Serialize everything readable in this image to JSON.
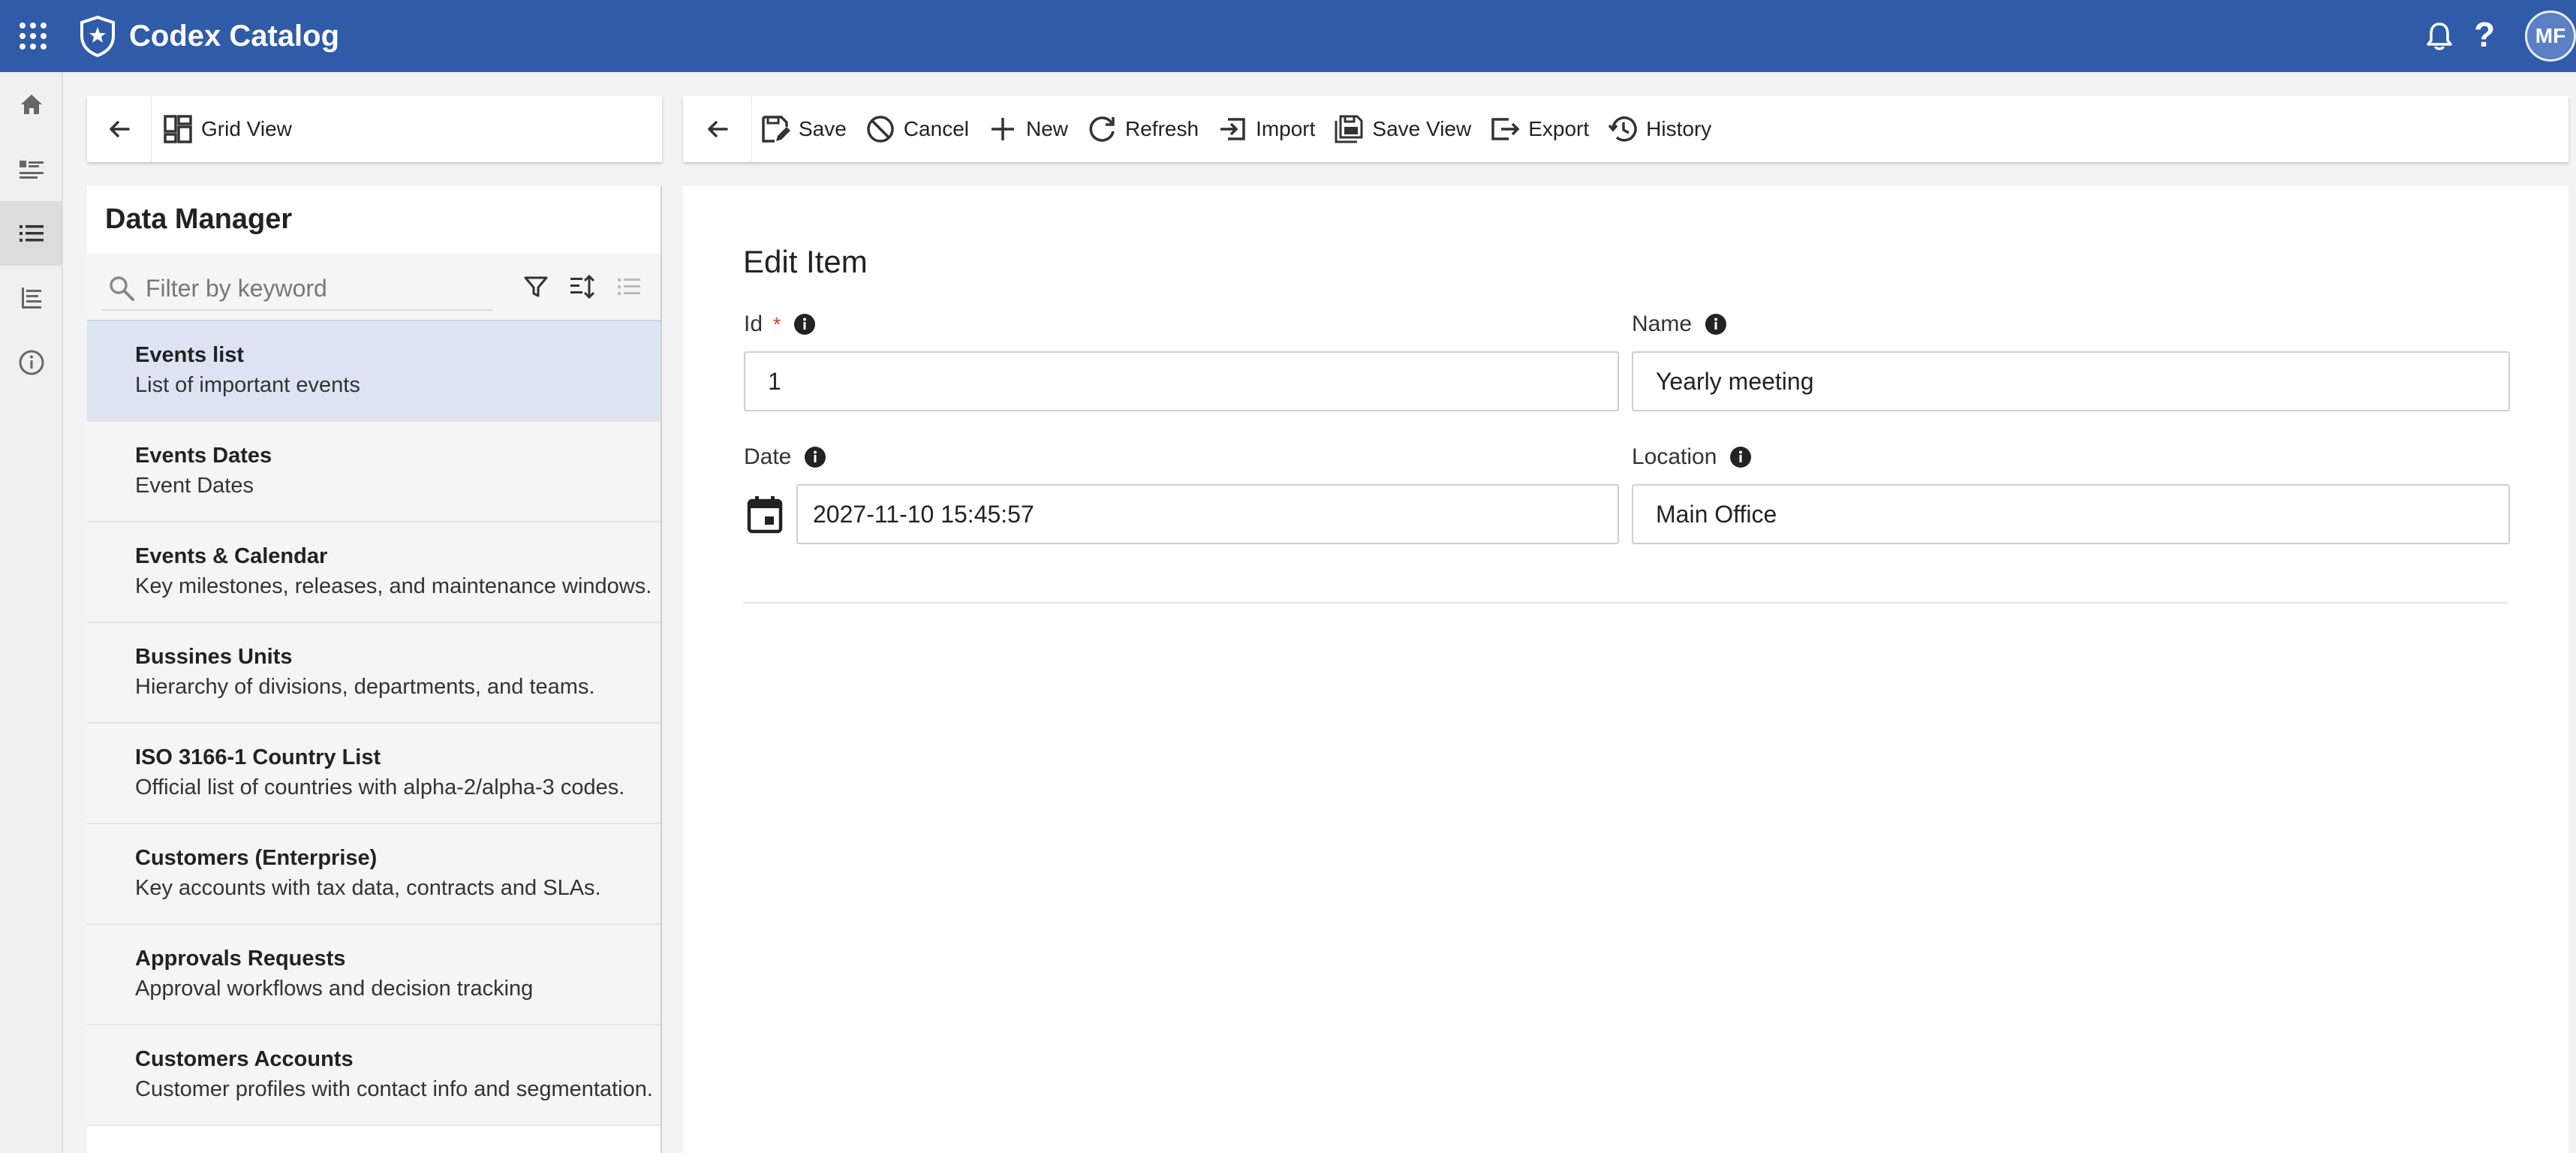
{
  "header": {
    "app_title": "Codex Catalog",
    "avatar_initials": "MF",
    "help_glyph": "?",
    "brand_color": "#2f5ba8"
  },
  "left_rail": {
    "items": [
      {
        "icon": "home-icon"
      },
      {
        "icon": "list-detail-icon"
      },
      {
        "icon": "list-icon",
        "active": true
      },
      {
        "icon": "tree-list-icon"
      },
      {
        "icon": "info-icon"
      }
    ]
  },
  "list_toolbar": {
    "grid_view_label": "Grid View"
  },
  "list_panel": {
    "title": "Data Manager",
    "filter_placeholder": "Filter by keyword",
    "items": [
      {
        "title": "Events list",
        "description": "List of important events",
        "selected": true
      },
      {
        "title": "Events Dates",
        "description": "Event Dates"
      },
      {
        "title": "Events & Calendar",
        "description": "Key milestones, releases, and maintenance windows."
      },
      {
        "title": "Bussines Units",
        "description": "Hierarchy of divisions, departments, and teams."
      },
      {
        "title": "ISO 3166-1 Country List",
        "description": "Official list of countries with alpha-2/alpha-3 codes."
      },
      {
        "title": "Customers (Enterprise)",
        "description": "Key accounts with tax data, contracts and SLAs."
      },
      {
        "title": "Approvals Requests",
        "description": "Approval workflows and decision tracking"
      },
      {
        "title": "Customers Accounts",
        "description": "Customer profiles with contact info and segmentation."
      }
    ]
  },
  "main_toolbar": {
    "save": "Save",
    "cancel": "Cancel",
    "new": "New",
    "refresh": "Refresh",
    "import": "Import",
    "save_view": "Save View",
    "export": "Export",
    "history": "History"
  },
  "form": {
    "title": "Edit Item",
    "id_label": "Id",
    "id_required_marker": "*",
    "id_value": "1",
    "name_label": "Name",
    "name_value": "Yearly meeting",
    "date_label": "Date",
    "date_value": "2027-11-10 15:45:57",
    "location_label": "Location",
    "location_value": "Main Office"
  }
}
